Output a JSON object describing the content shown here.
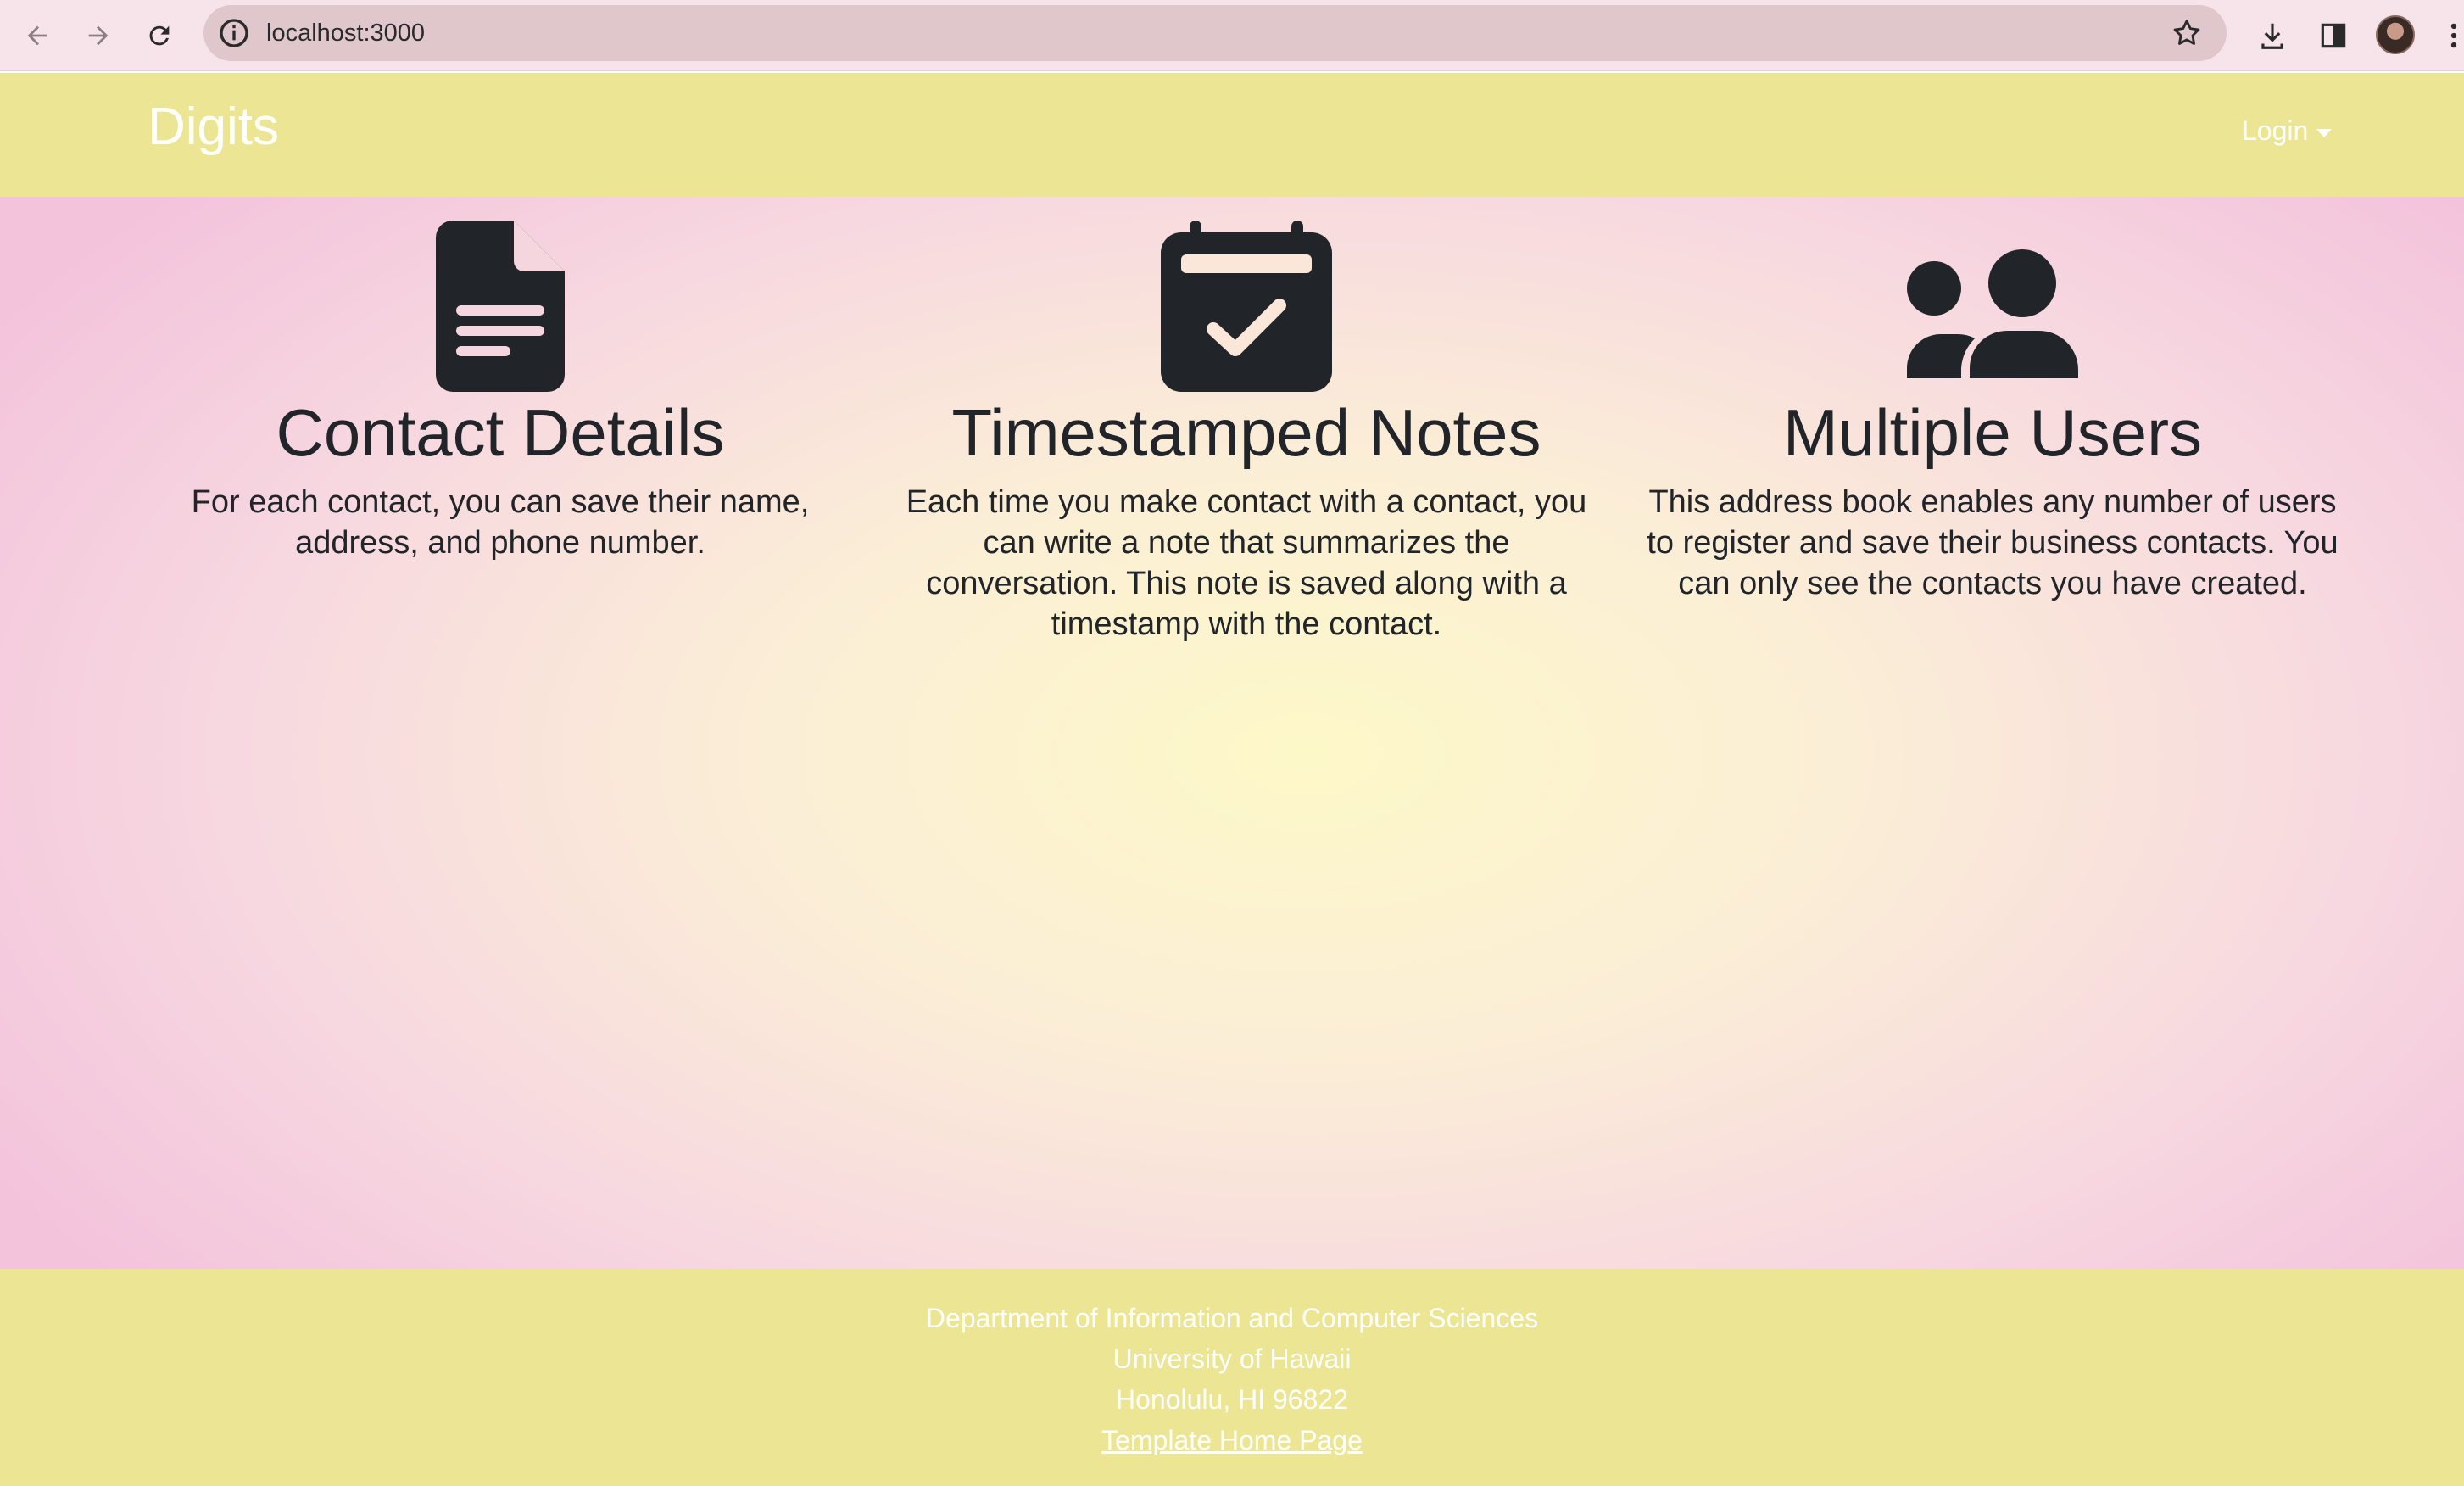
{
  "browser": {
    "url": "localhost:3000"
  },
  "navbar": {
    "brand": "Digits",
    "login_label": "Login"
  },
  "features": [
    {
      "icon": "file-text-icon",
      "title": "Contact Details",
      "description": "For each contact, you can save their name, address, and phone number."
    },
    {
      "icon": "calendar-check-icon",
      "title": "Timestamped Notes",
      "description": "Each time you make contact with a contact, you can write a note that summarizes the conversation. This note is saved along with a timestamp with the contact."
    },
    {
      "icon": "users-icon",
      "title": "Multiple Users",
      "description": "This address book enables any number of users to register and save their business contacts. You can only see the contacts you have created."
    }
  ],
  "footer": {
    "line1": "Department of Information and Computer Sciences",
    "line2": "University of Hawaii",
    "line3": "Honolulu, HI 96822",
    "link_label": "Template Home Page"
  },
  "colors": {
    "navbar_bg": "#ece694",
    "footer_bg": "#ece694",
    "icon_color": "#212529",
    "text_color": "#212529"
  }
}
